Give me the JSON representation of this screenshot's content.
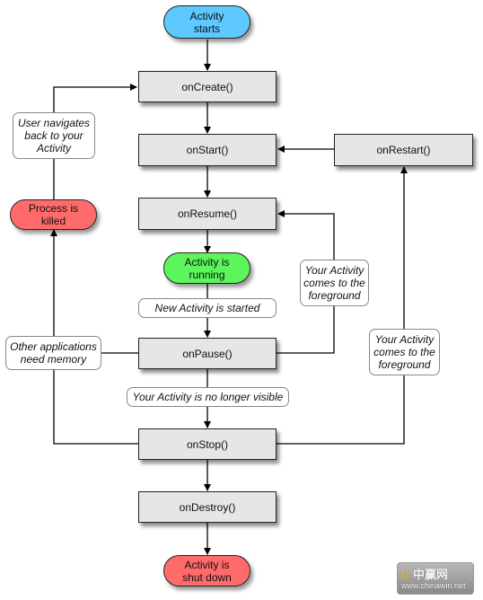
{
  "colors": {
    "start": "#5ec9ff",
    "running": "#5cf55c",
    "end": "#ff6b6b",
    "method_fill": "#e6e6e6"
  },
  "terminals": {
    "activity_starts": "Activity\nstarts",
    "process_killed": "Process is\nkilled",
    "activity_running": "Activity is\nrunning",
    "activity_shut_down": "Activity is\nshut down"
  },
  "methods": {
    "on_create": "onCreate()",
    "on_start": "onStart()",
    "on_restart": "onRestart()",
    "on_resume": "onResume()",
    "on_pause": "onPause()",
    "on_stop": "onStop()",
    "on_destroy": "onDestroy()"
  },
  "notes": {
    "user_navigates_back": "User navigates\nback to your\nActivity",
    "new_activity_started": "New Activity is started",
    "foreground_from_pause": "Your Activity\ncomes to the\nforeground",
    "other_apps_need_memory": "Other applications\nneed memory",
    "no_longer_visible": "Your Activity is no longer visible",
    "foreground_from_stop": "Your Activity\ncomes to the\nforeground"
  },
  "watermark": {
    "logo_mark": "C",
    "logo_text": "中赢网",
    "url": "www.chinawin.net"
  }
}
